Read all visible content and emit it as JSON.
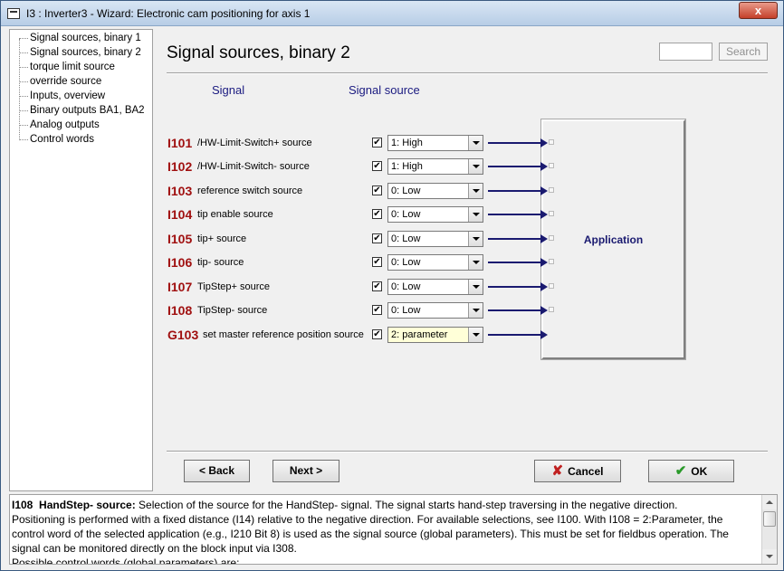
{
  "window": {
    "title": "I3 : Inverter3 - Wizard: Electronic cam positioning for axis 1",
    "close": "x"
  },
  "sidebar": {
    "items": [
      {
        "label": "Signal sources, binary 1"
      },
      {
        "label": "Signal sources, binary 2"
      },
      {
        "label": "torque limit source"
      },
      {
        "label": "override source"
      },
      {
        "label": "Inputs, overview"
      },
      {
        "label": "Binary outputs BA1, BA2"
      },
      {
        "label": "Analog outputs"
      },
      {
        "label": "Control words"
      }
    ]
  },
  "main": {
    "title": "Signal sources, binary 2",
    "search": {
      "value": "",
      "button": "Search"
    },
    "col_signal": "Signal",
    "col_source": "Signal source",
    "rows": [
      {
        "code": "I101",
        "desc": "/HW-Limit-Switch+ source",
        "checked": "✔",
        "source": "1: High"
      },
      {
        "code": "I102",
        "desc": "/HW-Limit-Switch- source",
        "checked": "✔",
        "source": "1: High"
      },
      {
        "code": "I103",
        "desc": "reference switch source",
        "checked": "✔",
        "source": "0:  Low"
      },
      {
        "code": "I104",
        "desc": "tip enable source",
        "checked": "✔",
        "source": "0:  Low"
      },
      {
        "code": "I105",
        "desc": "tip+ source",
        "checked": "✔",
        "source": "0:  Low"
      },
      {
        "code": "I106",
        "desc": "tip- source",
        "checked": "✔",
        "source": "0:  Low"
      },
      {
        "code": "I107",
        "desc": "TipStep+ source",
        "checked": "✔",
        "source": "0:  Low"
      },
      {
        "code": "I108",
        "desc": "TipStep- source",
        "checked": "✔",
        "source": "0:  Low"
      },
      {
        "code": "G103",
        "desc": "set master reference position source",
        "checked": "✔",
        "source": "2:  parameter"
      }
    ],
    "app_label": "Application",
    "buttons": {
      "back": "< Back",
      "next": "Next >",
      "cancel": "Cancel",
      "ok": "OK"
    }
  },
  "help": {
    "code": "I108",
    "title": "HandStep- source:",
    "lines": [
      " Selection of the source for the HandStep- signal. The signal starts hand-step traversing in the negative direction.",
      "Positioning is performed with a fixed distance (I14) relative to the negative direction. For available selections, see I100. With I108 = 2:Parameter, the",
      "control word of the selected application (e.g., I210 Bit 8) is used as the signal source (global parameters). This must be set for fieldbus operation. The",
      "signal can be monitored directly on the block input via I308.",
      "Possible control words (global parameters) are:"
    ]
  }
}
